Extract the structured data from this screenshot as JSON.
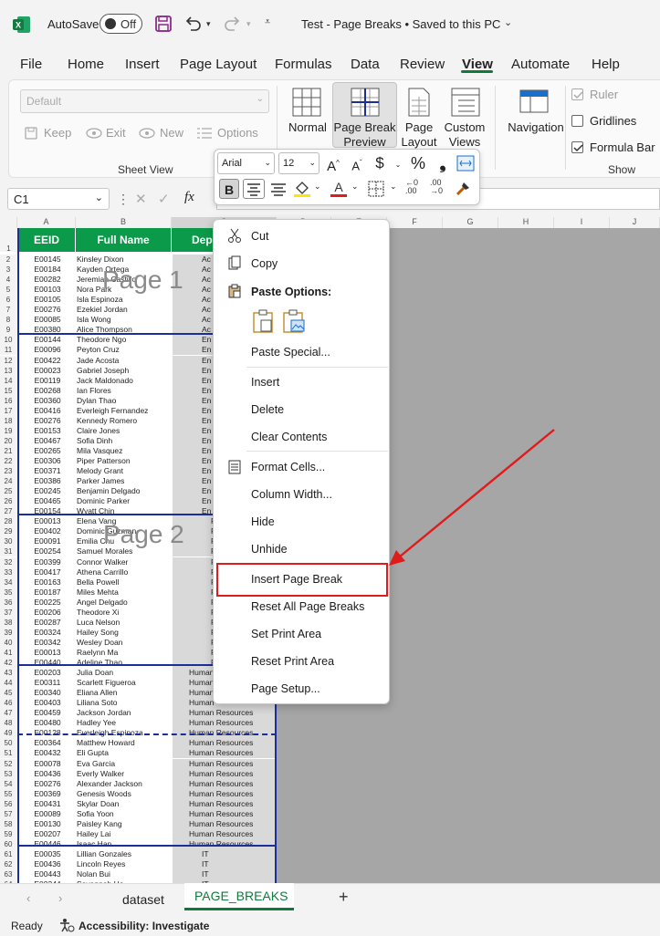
{
  "titlebar": {
    "autosave_label": "AutoSave",
    "toggle_state": "Off",
    "document_title": "Test - Page Breaks • Saved to this PC"
  },
  "menu": {
    "items": [
      "File",
      "Home",
      "Insert",
      "Page Layout",
      "Formulas",
      "Data",
      "Review",
      "View",
      "Automate",
      "Help"
    ],
    "active": "View"
  },
  "ribbon": {
    "sheet_view": {
      "dropdown_value": "Default",
      "keep": "Keep",
      "exit": "Exit",
      "new": "New",
      "options": "Options",
      "group_label": "Sheet View"
    },
    "workbook_views": {
      "normal": "Normal",
      "page_break_preview_1": "Page Break",
      "page_break_preview_2": "Preview",
      "page_layout_1": "Page",
      "page_layout_2": "Layout",
      "custom_views_1": "Custom",
      "custom_views_2": "Views"
    },
    "navigation": "Navigation",
    "show": {
      "ruler": "Ruler",
      "gridlines": "Gridlines",
      "formula_bar": "Formula Bar",
      "group_label": "Show"
    }
  },
  "formula_bar": {
    "name_box": "C1",
    "fx": "fx"
  },
  "mini_toolbar": {
    "font": "Arial",
    "size": "12",
    "bold": "B"
  },
  "grid": {
    "column_letters": [
      "A",
      "B",
      "C",
      "D",
      "E",
      "F",
      "G",
      "H",
      "I",
      "J"
    ],
    "headers": {
      "a": "EEID",
      "b": "Full Name",
      "c": "Dep"
    },
    "watermark_1": "Page 1",
    "watermark_2": "Page 2",
    "rows": [
      {
        "n": "2",
        "id": "E00145",
        "name": "Kinsley Dixon",
        "dept": "Ac"
      },
      {
        "n": "3",
        "id": "E00184",
        "name": "Kayden Ortega",
        "dept": "Ac"
      },
      {
        "n": "4",
        "id": "E00282",
        "name": "Jeremiah Castillo",
        "dept": "Ac"
      },
      {
        "n": "5",
        "id": "E00103",
        "name": "Nora Park",
        "dept": "Ac"
      },
      {
        "n": "6",
        "id": "E00105",
        "name": "Isla Espinoza",
        "dept": "Ac"
      },
      {
        "n": "7",
        "id": "E00276",
        "name": "Ezekiel Jordan",
        "dept": "Ac"
      },
      {
        "n": "8",
        "id": "E00085",
        "name": "Isla Wong",
        "dept": "Ac"
      },
      {
        "n": "9",
        "id": "E00380",
        "name": "Alice Thompson",
        "dept": "Ac"
      },
      {
        "n": "10",
        "id": "E00144",
        "name": "Theodore Ngo",
        "dept": "En"
      },
      {
        "n": "11",
        "id": "E00096",
        "name": "Peyton Cruz",
        "dept": "En"
      },
      {
        "n": "12",
        "id": "E00422",
        "name": "Jade Acosta",
        "dept": "En"
      },
      {
        "n": "13",
        "id": "E00023",
        "name": "Gabriel Joseph",
        "dept": "En"
      },
      {
        "n": "14",
        "id": "E00119",
        "name": "Jack Maldonado",
        "dept": "En"
      },
      {
        "n": "15",
        "id": "E00268",
        "name": "Ian Flores",
        "dept": "En"
      },
      {
        "n": "16",
        "id": "E00360",
        "name": "Dylan Thao",
        "dept": "En"
      },
      {
        "n": "17",
        "id": "E00416",
        "name": "Everleigh Fernandez",
        "dept": "En"
      },
      {
        "n": "18",
        "id": "E00276",
        "name": "Kennedy Romero",
        "dept": "En"
      },
      {
        "n": "19",
        "id": "E00153",
        "name": "Claire Jones",
        "dept": "En"
      },
      {
        "n": "20",
        "id": "E00467",
        "name": "Sofia Dinh",
        "dept": "En"
      },
      {
        "n": "21",
        "id": "E00265",
        "name": "Mila Vasquez",
        "dept": "En"
      },
      {
        "n": "22",
        "id": "E00306",
        "name": "Piper Patterson",
        "dept": "En"
      },
      {
        "n": "23",
        "id": "E00371",
        "name": "Melody Grant",
        "dept": "En"
      },
      {
        "n": "24",
        "id": "E00386",
        "name": "Parker James",
        "dept": "En"
      },
      {
        "n": "25",
        "id": "E00245",
        "name": "Benjamin Delgado",
        "dept": "En"
      },
      {
        "n": "26",
        "id": "E00465",
        "name": "Dominic Parker",
        "dept": "En"
      },
      {
        "n": "27",
        "id": "E00154",
        "name": "Wyatt Chin",
        "dept": "En"
      },
      {
        "n": "28",
        "id": "E00013",
        "name": "Elena Vang",
        "dept": "F"
      },
      {
        "n": "29",
        "id": "E00402",
        "name": "Dominic Guzman",
        "dept": "F"
      },
      {
        "n": "30",
        "id": "E00091",
        "name": "Emilia Chu",
        "dept": "F"
      },
      {
        "n": "31",
        "id": "E00254",
        "name": "Samuel Morales",
        "dept": "F"
      },
      {
        "n": "32",
        "id": "E00399",
        "name": "Connor Walker",
        "dept": "F"
      },
      {
        "n": "33",
        "id": "E00417",
        "name": "Athena Carrillo",
        "dept": "F"
      },
      {
        "n": "34",
        "id": "E00163",
        "name": "Bella Powell",
        "dept": "F"
      },
      {
        "n": "35",
        "id": "E00187",
        "name": "Miles Mehta",
        "dept": "F"
      },
      {
        "n": "36",
        "id": "E00225",
        "name": "Angel Delgado",
        "dept": "F"
      },
      {
        "n": "37",
        "id": "E00206",
        "name": "Theodore Xi",
        "dept": "F"
      },
      {
        "n": "38",
        "id": "E00287",
        "name": "Luca Nelson",
        "dept": "F"
      },
      {
        "n": "39",
        "id": "E00324",
        "name": "Hailey Song",
        "dept": "F"
      },
      {
        "n": "40",
        "id": "E00342",
        "name": "Wesley Doan",
        "dept": "F"
      },
      {
        "n": "41",
        "id": "E00013",
        "name": "Raelynn Ma",
        "dept": "F"
      },
      {
        "n": "42",
        "id": "E00440",
        "name": "Adeline Thao",
        "dept": "F"
      },
      {
        "n": "43",
        "id": "E00203",
        "name": "Julia Doan",
        "dept": "Human"
      },
      {
        "n": "44",
        "id": "E00311",
        "name": "Scarlett Figueroa",
        "dept": "Human"
      },
      {
        "n": "45",
        "id": "E00340",
        "name": "Eliana Allen",
        "dept": "Human"
      },
      {
        "n": "46",
        "id": "E00403",
        "name": "Liliana Soto",
        "dept": "Human"
      },
      {
        "n": "47",
        "id": "E00459",
        "name": "Jackson Jordan",
        "dept": "Human Resources"
      },
      {
        "n": "48",
        "id": "E00480",
        "name": "Hadley Yee",
        "dept": "Human Resources"
      },
      {
        "n": "49",
        "id": "E00128",
        "name": "Everleigh Espinoza",
        "dept": "Human Resources"
      },
      {
        "n": "50",
        "id": "E00364",
        "name": "Matthew Howard",
        "dept": "Human Resources"
      },
      {
        "n": "51",
        "id": "E00432",
        "name": "Eli Gupta",
        "dept": "Human Resources"
      },
      {
        "n": "52",
        "id": "E00078",
        "name": "Eva Garcia",
        "dept": "Human Resources"
      },
      {
        "n": "53",
        "id": "E00436",
        "name": "Everly Walker",
        "dept": "Human Resources"
      },
      {
        "n": "54",
        "id": "E00276",
        "name": "Alexander Jackson",
        "dept": "Human Resources"
      },
      {
        "n": "55",
        "id": "E00369",
        "name": "Genesis Woods",
        "dept": "Human Resources"
      },
      {
        "n": "56",
        "id": "E00431",
        "name": "Skylar Doan",
        "dept": "Human Resources"
      },
      {
        "n": "57",
        "id": "E00089",
        "name": "Sofia Yoon",
        "dept": "Human Resources"
      },
      {
        "n": "58",
        "id": "E00130",
        "name": "Paisley Kang",
        "dept": "Human Resources"
      },
      {
        "n": "59",
        "id": "E00207",
        "name": "Hailey Lai",
        "dept": "Human Resources"
      },
      {
        "n": "60",
        "id": "E00446",
        "name": "Isaac Han",
        "dept": "Human Resources"
      },
      {
        "n": "61",
        "id": "E00035",
        "name": "Lillian Gonzales",
        "dept": "IT"
      },
      {
        "n": "62",
        "id": "E00436",
        "name": "Lincoln Reyes",
        "dept": "IT"
      },
      {
        "n": "63",
        "id": "E00443",
        "name": "Nolan Bui",
        "dept": "IT"
      },
      {
        "n": "64",
        "id": "E00344",
        "name": "Savannah He",
        "dept": "IT"
      }
    ]
  },
  "context_menu": {
    "cut": "Cut",
    "copy": "Copy",
    "paste_options": "Paste Options:",
    "paste_special": "Paste Special...",
    "insert": "Insert",
    "delete": "Delete",
    "clear_contents": "Clear Contents",
    "format_cells": "Format Cells...",
    "column_width": "Column Width...",
    "hide": "Hide",
    "unhide": "Unhide",
    "insert_page_break": "Insert Page Break",
    "reset_all_page_breaks": "Reset All Page Breaks",
    "set_print_area": "Set Print Area",
    "reset_print_area": "Reset Print Area",
    "page_setup": "Page Setup..."
  },
  "sheet_tabs": {
    "tabs": [
      "dataset",
      "PAGE_BREAKS"
    ],
    "active": "PAGE_BREAKS",
    "add": "+"
  },
  "status_bar": {
    "ready": "Ready",
    "accessibility": "Accessibility: Investigate"
  },
  "colors": {
    "excel_green": "#0b9a49",
    "page_break_line": "#1c2f99",
    "highlight_red": "#e01b1b",
    "annotation_arrow": "#e01b1b"
  }
}
